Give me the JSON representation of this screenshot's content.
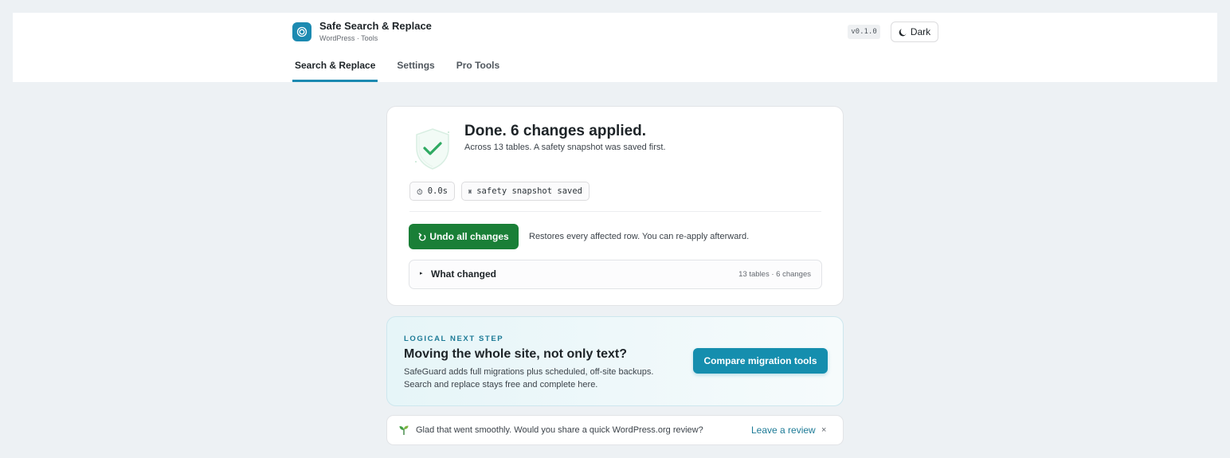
{
  "header": {
    "title": "Safe Search & Replace",
    "subtitle": "WordPress · Tools",
    "version": "v0.1.0",
    "theme_toggle_label": "Dark",
    "tabs": [
      {
        "label": "Search & Replace",
        "active": true
      },
      {
        "label": "Settings",
        "active": false
      },
      {
        "label": "Pro Tools",
        "active": false
      }
    ]
  },
  "result": {
    "title": "Done. 6 changes applied.",
    "subtitle": "Across 13 tables. A safety snapshot was saved first.",
    "duration": "0.0s",
    "snapshot_label": "safety snapshot saved",
    "undo_label": "Undo all changes",
    "undo_note": "Restores every affected row. You can re-apply afterward.",
    "changes_label": "What changed",
    "changes_count": "13 tables · 6 changes"
  },
  "promo": {
    "eyebrow": "LOGICAL NEXT STEP",
    "title": "Moving the whole site, not only text?",
    "description": "SafeGuard adds full migrations plus scheduled, off-site backups. Search and replace stays free and complete here.",
    "button_label": "Compare migration tools"
  },
  "review": {
    "text": "Glad that went smoothly. Would you share a quick WordPress.org review?",
    "link_label": "Leave a review",
    "close_label": "×"
  },
  "icons": {
    "brand": "target-icon",
    "theme": "moon-icon",
    "success": "shield-check-icon",
    "timer": "stopwatch-icon",
    "snapshot": "square-icon",
    "undo": "undo-arrow-icon",
    "disclosure": "caret-right-icon",
    "review": "sprout-icon"
  },
  "colors": {
    "accent": "#1c8ab1",
    "success": "#1a7f37",
    "promo_button": "#158eae",
    "link": "#1c7a96"
  }
}
